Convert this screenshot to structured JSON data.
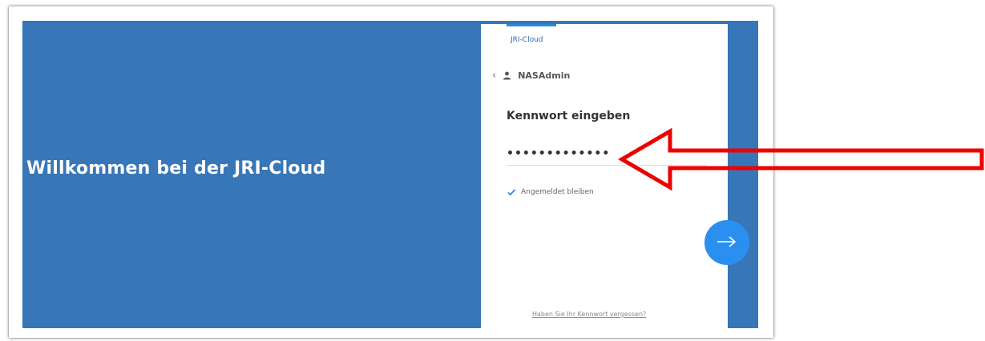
{
  "hero": {
    "title": "Willkommen bei der JRI-Cloud",
    "background_color": "#3776b7"
  },
  "login": {
    "brand_label": "JRI-Cloud",
    "back_icon": "chevron-left-icon",
    "user_icon": "user-icon",
    "username": "NASAdmin",
    "heading": "Kennwort eingeben",
    "password_value": "•••••••••••••",
    "remember_me": {
      "label": "Angemeldet bleiben",
      "checked": true
    },
    "submit_icon": "arrow-right-icon",
    "forgot_link": "Haben Sie Ihr Kennwort vergessen?",
    "accent_color": "#2b8ff0"
  },
  "annotation": {
    "icon": "arrow-left-icon",
    "color": "#ee0000"
  }
}
